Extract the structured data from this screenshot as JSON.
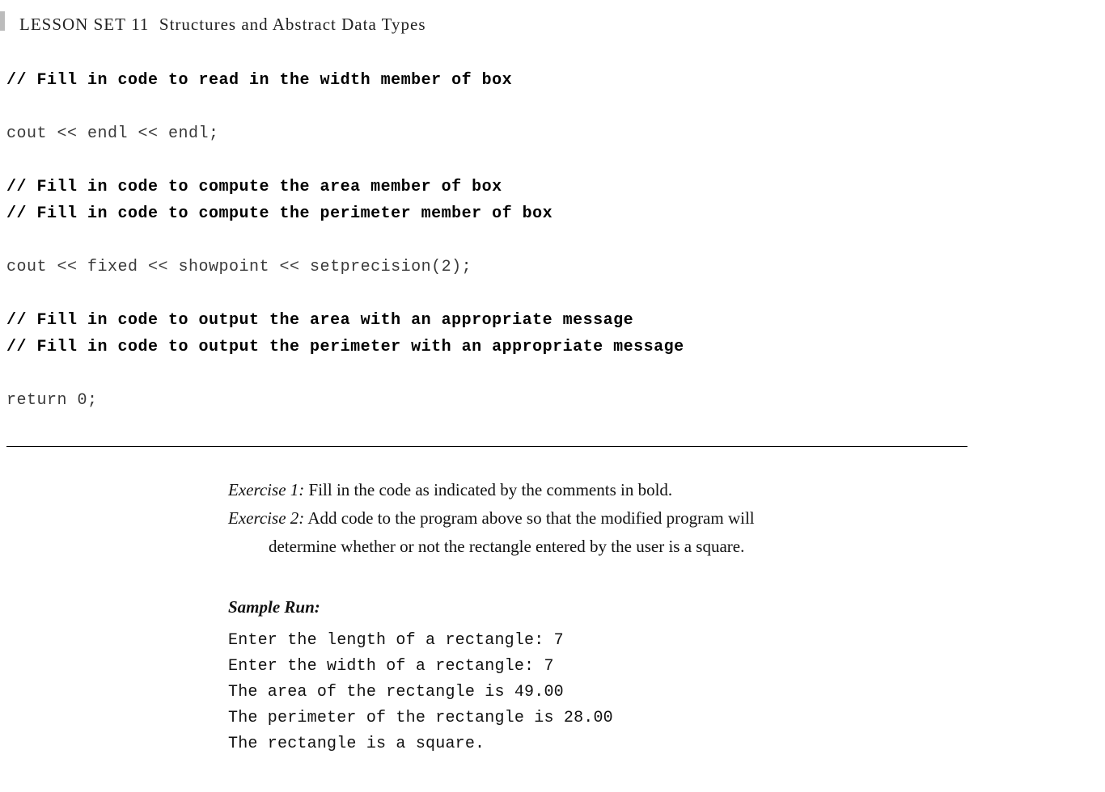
{
  "header": {
    "lesson_set": "LESSON  SET",
    "lesson_number": "11",
    "lesson_title": "Structures  and  Abstract  Data  Types"
  },
  "code": {
    "l1": "// Fill in code to read in the width member of box",
    "l2": "cout << endl << endl;",
    "l3": "// Fill in code to compute the area member of box",
    "l4": "// Fill in code to compute the perimeter member of box",
    "l5": "cout << fixed << showpoint << setprecision(2);",
    "l6": "// Fill in code to output the area with an appropriate message",
    "l7": "// Fill in code to output the perimeter with an appropriate message",
    "l8": "return 0;"
  },
  "exercises": {
    "e1_label": "Exercise 1:",
    "e1_text": " Fill  in  the  code   as  indicated by  the  comments  in  bold.",
    "e2_label": "Exercise 2:",
    "e2_text": " Add  code   to  the  program   above   so  that  the  modified  program   will",
    "e2_cont": "determine  whether  or  not  the  rectangle  entered  by  the  user  is  a  square."
  },
  "sample": {
    "label": "Sample Run:",
    "lines": {
      "s1": "Enter the length of a rectangle: 7",
      "s2": "Enter the width of a rectangle: 7",
      "s3": "The area of the rectangle is 49.00",
      "s4": "The perimeter of the rectangle is 28.00",
      "s5": "The rectangle is a square."
    }
  }
}
